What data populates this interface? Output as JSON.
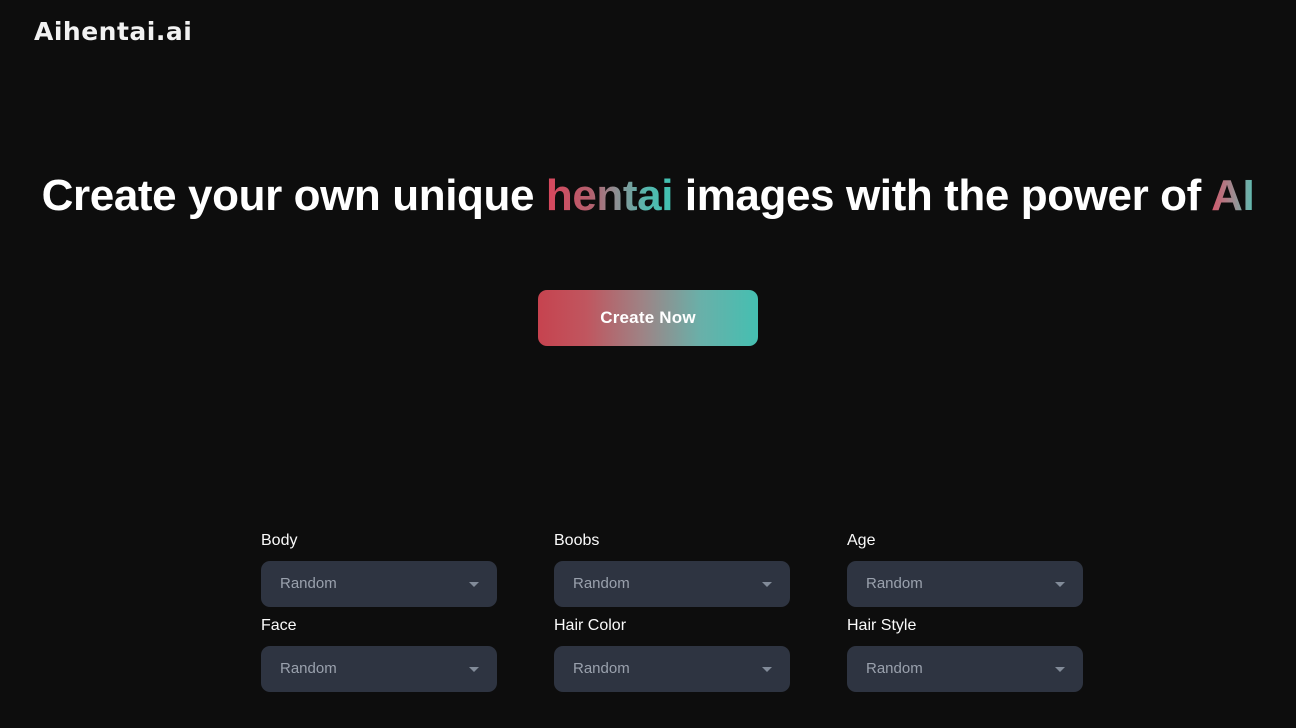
{
  "site": {
    "logo": "Aihentai.ai",
    "background_color": "#0d0d0d"
  },
  "hero": {
    "headline_part1": "Create your own unique ",
    "headline_highlight": "hentai",
    "headline_part2": " images with the power of ",
    "headline_highlight2": "AI",
    "gradient_start": "#d9465c",
    "gradient_end": "#3fc2b2"
  },
  "cta": {
    "label": "Create Now",
    "gradient_start": "#c6434f",
    "gradient_end": "#45bfb1"
  },
  "options": {
    "fields": [
      {
        "label": "Body",
        "value": "Random",
        "arrow": "chevron-down-icon"
      },
      {
        "label": "Boobs",
        "value": "Random",
        "arrow": "chevron-down-icon"
      },
      {
        "label": "Age",
        "value": "Random",
        "arrow": "chevron-down-icon"
      },
      {
        "label": "Face",
        "value": "Random",
        "arrow": "chevron-down-icon"
      },
      {
        "label": "Hair Color",
        "value": "Random",
        "arrow": "chevron-down-icon"
      },
      {
        "label": "Hair Style",
        "value": "Random",
        "arrow": "chevron-down-icon"
      }
    ],
    "select_background": "#2e3441",
    "select_text_color": "#9aa1ad"
  }
}
